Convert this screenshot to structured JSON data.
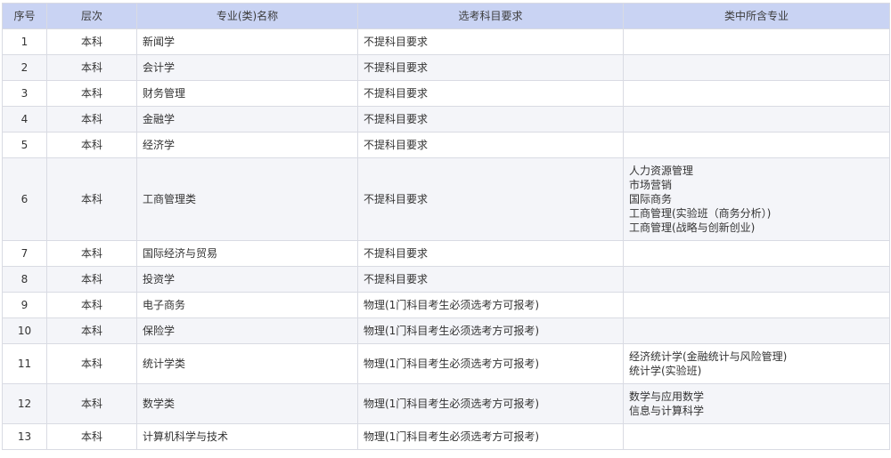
{
  "table": {
    "headers": [
      "序号",
      "层次",
      "专业(类)名称",
      "选考科目要求",
      "类中所含专业"
    ],
    "rows": [
      {
        "idx": "1",
        "level": "本科",
        "name": "新闻学",
        "req": "不提科目要求",
        "majors": []
      },
      {
        "idx": "2",
        "level": "本科",
        "name": "会计学",
        "req": "不提科目要求",
        "majors": []
      },
      {
        "idx": "3",
        "level": "本科",
        "name": "财务管理",
        "req": "不提科目要求",
        "majors": []
      },
      {
        "idx": "4",
        "level": "本科",
        "name": "金融学",
        "req": "不提科目要求",
        "majors": []
      },
      {
        "idx": "5",
        "level": "本科",
        "name": "经济学",
        "req": "不提科目要求",
        "majors": []
      },
      {
        "idx": "6",
        "level": "本科",
        "name": "工商管理类",
        "req": "不提科目要求",
        "majors": [
          "人力资源管理",
          "市场营销",
          "国际商务",
          "工商管理(实验班（商务分析）)",
          "工商管理(战略与创新创业)"
        ]
      },
      {
        "idx": "7",
        "level": "本科",
        "name": "国际经济与贸易",
        "req": "不提科目要求",
        "majors": []
      },
      {
        "idx": "8",
        "level": "本科",
        "name": "投资学",
        "req": "不提科目要求",
        "majors": []
      },
      {
        "idx": "9",
        "level": "本科",
        "name": "电子商务",
        "req": "物理(1门科目考生必须选考方可报考)",
        "majors": []
      },
      {
        "idx": "10",
        "level": "本科",
        "name": "保险学",
        "req": "物理(1门科目考生必须选考方可报考)",
        "majors": []
      },
      {
        "idx": "11",
        "level": "本科",
        "name": "统计学类",
        "req": "物理(1门科目考生必须选考方可报考)",
        "majors": [
          "经济统计学(金融统计与风险管理)",
          "统计学(实验班)"
        ]
      },
      {
        "idx": "12",
        "level": "本科",
        "name": "数学类",
        "req": "物理(1门科目考生必须选考方可报考)",
        "majors": [
          "数学与应用数学",
          "信息与计算科学"
        ]
      },
      {
        "idx": "13",
        "level": "本科",
        "name": "计算机科学与技术",
        "req": "物理(1门科目考生必须选考方可报考)",
        "majors": []
      }
    ]
  }
}
